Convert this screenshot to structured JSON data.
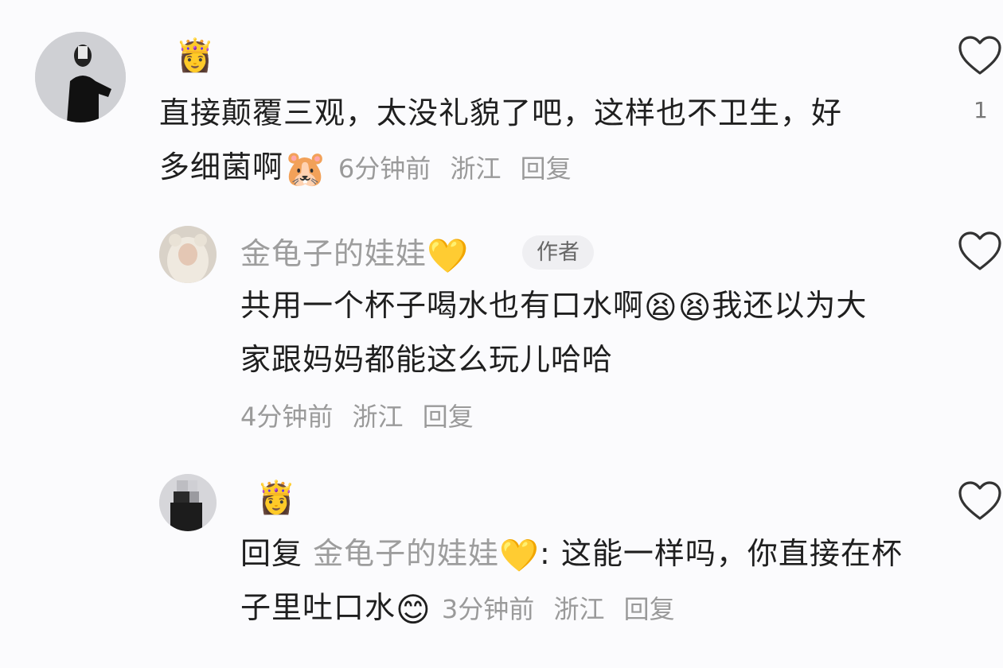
{
  "comments": [
    {
      "badge": "👸",
      "text": "直接颠覆三观，太没礼貌了吧，这样也不卫生，好多细菌啊",
      "emoji": "🐹",
      "time": "6分钟前",
      "location": "浙江",
      "reply": "回复",
      "likes": "1"
    },
    {
      "name": "金龟子的娃娃",
      "name_emoji": "💛",
      "author_tag": "作者",
      "text_a": "共用一个杯子喝水也有口水啊",
      "text_emojis": "😫😫",
      "text_b": "我还以为大家跟妈妈都能这么玩儿哈哈",
      "time": "4分钟前",
      "location": "浙江",
      "reply": "回复"
    },
    {
      "badge": "👸",
      "reply_prefix": "回复",
      "reply_to": "金龟子的娃娃",
      "reply_to_emoji": "💛",
      "text": ": 这能一样吗，你直接在杯子里吐口水",
      "emoji": "😊",
      "time": "3分钟前",
      "location": "浙江",
      "reply": "回复"
    }
  ],
  "icons": {
    "like": "heart-outline-icon"
  }
}
